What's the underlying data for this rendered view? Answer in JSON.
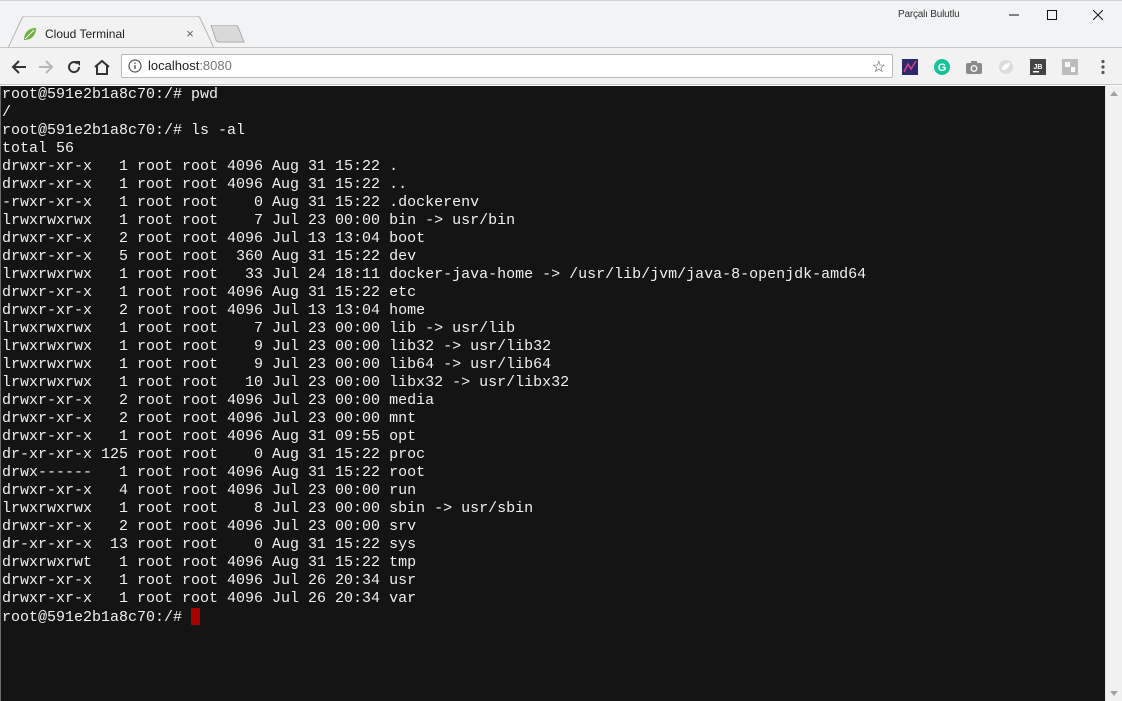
{
  "window": {
    "profile_name": "Parçalı Bulutlu",
    "minimize_label": "—",
    "maximize_label": "☐",
    "close_label": "✕"
  },
  "tab": {
    "title": "Cloud Terminal",
    "close_label": "×",
    "favicon": "leaf-icon"
  },
  "toolbar": {
    "url_host": "localhost",
    "url_port": ":8080",
    "icons": [
      "back-icon",
      "forward-icon",
      "reload-icon",
      "home-icon",
      "info-icon",
      "bookmark-star-icon"
    ],
    "extensions": [
      "extension-icon-1",
      "grammarly-icon",
      "camera-icon",
      "extension-icon-4",
      "jetbrains-icon",
      "extension-icon-6",
      "menu-icon"
    ]
  },
  "terminal": {
    "lines": [
      "root@591e2b1a8c70:/# pwd",
      "/",
      "root@591e2b1a8c70:/# ls -al",
      "total 56",
      "drwxr-xr-x   1 root root 4096 Aug 31 15:22 .",
      "drwxr-xr-x   1 root root 4096 Aug 31 15:22 ..",
      "-rwxr-xr-x   1 root root    0 Aug 31 15:22 .dockerenv",
      "lrwxrwxrwx   1 root root    7 Jul 23 00:00 bin -> usr/bin",
      "drwxr-xr-x   2 root root 4096 Jul 13 13:04 boot",
      "drwxr-xr-x   5 root root  360 Aug 31 15:22 dev",
      "lrwxrwxrwx   1 root root   33 Jul 24 18:11 docker-java-home -> /usr/lib/jvm/java-8-openjdk-amd64",
      "drwxr-xr-x   1 root root 4096 Aug 31 15:22 etc",
      "drwxr-xr-x   2 root root 4096 Jul 13 13:04 home",
      "lrwxrwxrwx   1 root root    7 Jul 23 00:00 lib -> usr/lib",
      "lrwxrwxrwx   1 root root    9 Jul 23 00:00 lib32 -> usr/lib32",
      "lrwxrwxrwx   1 root root    9 Jul 23 00:00 lib64 -> usr/lib64",
      "lrwxrwxrwx   1 root root   10 Jul 23 00:00 libx32 -> usr/libx32",
      "drwxr-xr-x   2 root root 4096 Jul 23 00:00 media",
      "drwxr-xr-x   2 root root 4096 Jul 23 00:00 mnt",
      "drwxr-xr-x   1 root root 4096 Aug 31 09:55 opt",
      "dr-xr-xr-x 125 root root    0 Aug 31 15:22 proc",
      "drwx------   1 root root 4096 Aug 31 15:22 root",
      "drwxr-xr-x   4 root root 4096 Jul 23 00:00 run",
      "lrwxrwxrwx   1 root root    8 Jul 23 00:00 sbin -> usr/sbin",
      "drwxr-xr-x   2 root root 4096 Jul 23 00:00 srv",
      "dr-xr-xr-x  13 root root    0 Aug 31 15:22 sys",
      "drwxrwxrwt   1 root root 4096 Aug 31 15:22 tmp",
      "drwxr-xr-x   1 root root 4096 Jul 26 20:34 usr",
      "drwxr-xr-x   1 root root 4096 Jul 26 20:34 var"
    ],
    "prompt": "root@591e2b1a8c70:/# ",
    "background": "#141414",
    "foreground": "#f0f0f0",
    "cursor_color": "#a60000"
  }
}
